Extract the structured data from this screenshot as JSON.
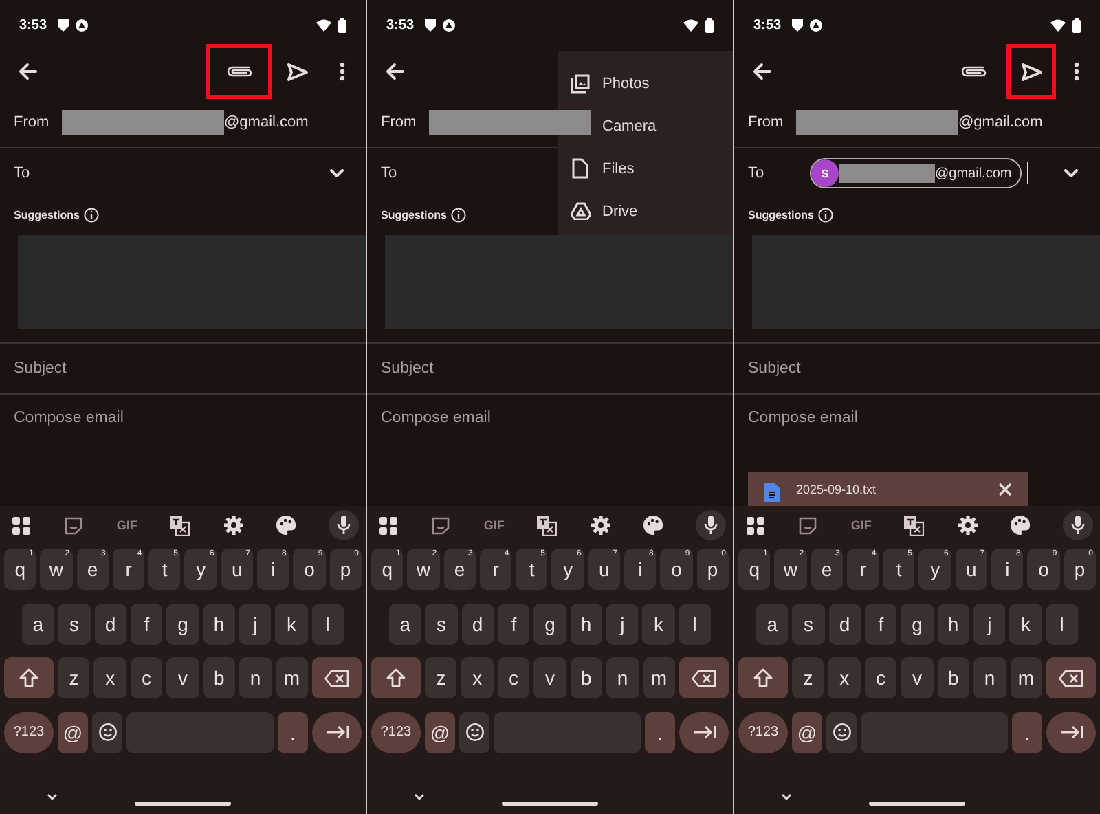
{
  "panels": [
    {
      "status": {
        "time": "3:53"
      },
      "toolbar": [
        {
          "kind": "back",
          "highlighted": false
        },
        {
          "kind": "attach",
          "highlighted": true
        },
        {
          "kind": "send",
          "highlighted": false
        },
        {
          "kind": "more",
          "highlighted": false
        }
      ],
      "from": {
        "label": "From",
        "suffix": "@gmail.com"
      },
      "to": {
        "label": "To"
      },
      "suggestions": {
        "label": "Suggestions"
      },
      "subject": {
        "placeholder": "Subject"
      },
      "body": {
        "placeholder": "Compose email"
      },
      "keyboard": {
        "tools": [
          {
            "kind": "apps"
          },
          {
            "kind": "sticker"
          },
          {
            "kind": "gif",
            "label": "GIF"
          },
          {
            "kind": "translate"
          },
          {
            "kind": "settings"
          },
          {
            "kind": "theme"
          },
          {
            "kind": "mic"
          }
        ],
        "top_row": [
          {
            "label": "q",
            "hint": "1"
          },
          {
            "label": "w",
            "hint": "2"
          },
          {
            "label": "e",
            "hint": "3"
          },
          {
            "label": "r",
            "hint": "4"
          },
          {
            "label": "t",
            "hint": "5"
          },
          {
            "label": "y",
            "hint": "6"
          },
          {
            "label": "u",
            "hint": "7"
          },
          {
            "label": "i",
            "hint": "8"
          },
          {
            "label": "o",
            "hint": "9"
          },
          {
            "label": "p",
            "hint": "0"
          }
        ],
        "middle_row": [
          "a",
          "s",
          "d",
          "f",
          "g",
          "h",
          "j",
          "k",
          "l"
        ],
        "bottom_letters": [
          "z",
          "x",
          "c",
          "v",
          "b",
          "n",
          "m"
        ],
        "bottom_row": [
          {
            "kind": "symbols",
            "label": "?123"
          },
          {
            "kind": "char",
            "label": "@"
          },
          {
            "kind": "emoji"
          },
          {
            "kind": "space"
          },
          {
            "kind": "char",
            "label": "."
          },
          {
            "kind": "enter"
          }
        ]
      }
    },
    {
      "status": {
        "time": "3:53"
      },
      "toolbar": [
        {
          "kind": "back",
          "highlighted": false
        }
      ],
      "menu": [
        {
          "kind": "photos",
          "label": "Photos"
        },
        {
          "kind": "camera",
          "label": "Camera"
        },
        {
          "kind": "files",
          "label": "Files"
        },
        {
          "kind": "drive",
          "label": "Drive"
        }
      ],
      "from": {
        "label": "From"
      },
      "to": {
        "label": "To"
      },
      "suggestions": {
        "label": "Suggestions"
      },
      "subject": {
        "placeholder": "Subject"
      },
      "body": {
        "placeholder": "Compose email"
      },
      "keyboard": {
        "tools": [
          {
            "kind": "apps"
          },
          {
            "kind": "sticker"
          },
          {
            "kind": "gif",
            "label": "GIF"
          },
          {
            "kind": "translate"
          },
          {
            "kind": "settings"
          },
          {
            "kind": "theme"
          },
          {
            "kind": "mic"
          }
        ],
        "top_row": [
          {
            "label": "q",
            "hint": "1"
          },
          {
            "label": "w",
            "hint": "2"
          },
          {
            "label": "e",
            "hint": "3"
          },
          {
            "label": "r",
            "hint": "4"
          },
          {
            "label": "t",
            "hint": "5"
          },
          {
            "label": "y",
            "hint": "6"
          },
          {
            "label": "u",
            "hint": "7"
          },
          {
            "label": "i",
            "hint": "8"
          },
          {
            "label": "o",
            "hint": "9"
          },
          {
            "label": "p",
            "hint": "0"
          }
        ],
        "middle_row": [
          "a",
          "s",
          "d",
          "f",
          "g",
          "h",
          "j",
          "k",
          "l"
        ],
        "bottom_letters": [
          "z",
          "x",
          "c",
          "v",
          "b",
          "n",
          "m"
        ],
        "bottom_row": [
          {
            "kind": "symbols",
            "label": "?123"
          },
          {
            "kind": "char",
            "label": "@"
          },
          {
            "kind": "emoji"
          },
          {
            "kind": "space"
          },
          {
            "kind": "char",
            "label": "."
          },
          {
            "kind": "enter"
          }
        ]
      }
    },
    {
      "status": {
        "time": "3:53"
      },
      "toolbar": [
        {
          "kind": "back",
          "highlighted": false
        },
        {
          "kind": "attach",
          "highlighted": false
        },
        {
          "kind": "send",
          "highlighted": true
        },
        {
          "kind": "more",
          "highlighted": false
        }
      ],
      "from": {
        "label": "From",
        "suffix": "@gmail.com"
      },
      "to": {
        "label": "To",
        "cursor": true,
        "chips": [
          {
            "initial": "S",
            "color": "#a746c6",
            "suffix": "@gmail.com"
          }
        ]
      },
      "suggestions": {
        "label": "Suggestions"
      },
      "subject": {
        "placeholder": "Subject"
      },
      "body": {
        "placeholder": "Compose email"
      },
      "attachments": [
        {
          "name": "2025-09-10.txt"
        }
      ],
      "keyboard": {
        "tools": [
          {
            "kind": "apps"
          },
          {
            "kind": "sticker"
          },
          {
            "kind": "gif",
            "label": "GIF"
          },
          {
            "kind": "translate"
          },
          {
            "kind": "settings"
          },
          {
            "kind": "theme"
          },
          {
            "kind": "mic"
          }
        ],
        "top_row": [
          {
            "label": "q",
            "hint": "1"
          },
          {
            "label": "w",
            "hint": "2"
          },
          {
            "label": "e",
            "hint": "3"
          },
          {
            "label": "r",
            "hint": "4"
          },
          {
            "label": "t",
            "hint": "5"
          },
          {
            "label": "y",
            "hint": "6"
          },
          {
            "label": "u",
            "hint": "7"
          },
          {
            "label": "i",
            "hint": "8"
          },
          {
            "label": "o",
            "hint": "9"
          },
          {
            "label": "p",
            "hint": "0"
          }
        ],
        "middle_row": [
          "a",
          "s",
          "d",
          "f",
          "g",
          "h",
          "j",
          "k",
          "l"
        ],
        "bottom_letters": [
          "z",
          "x",
          "c",
          "v",
          "b",
          "n",
          "m"
        ],
        "bottom_row": [
          {
            "kind": "symbols",
            "label": "?123"
          },
          {
            "kind": "char",
            "label": "@"
          },
          {
            "kind": "emoji"
          },
          {
            "kind": "space"
          },
          {
            "kind": "char",
            "label": "."
          },
          {
            "kind": "enter"
          }
        ]
      }
    }
  ]
}
